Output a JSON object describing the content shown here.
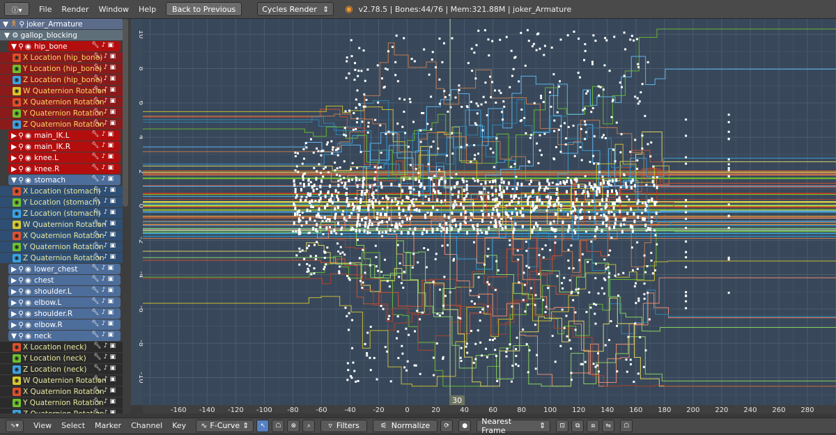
{
  "topbar": {
    "editor_icon": "info-icon",
    "menus": [
      "File",
      "Render",
      "Window",
      "Help"
    ],
    "back_button": "Back to Previous",
    "render_engine": "Cycles Render",
    "stats": "v2.78.5 | Bones:44/76  | Mem:321.88M | joker_Armature"
  },
  "channels": {
    "object": "joker_Armature",
    "action": "gallop_blocking",
    "rows": [
      {
        "label": "hip_bone",
        "type": "bone-red"
      },
      {
        "label": "X Location (hip_bone)",
        "type": "fc-red",
        "swatch": "#e0502c"
      },
      {
        "label": "Y Location (hip_bone)",
        "type": "fc-red",
        "swatch": "#6dc22d"
      },
      {
        "label": "Z Location (hip_bone)",
        "type": "fc-red",
        "swatch": "#3aa3e0"
      },
      {
        "label": "W Quaternion Rotation",
        "type": "fc-red",
        "swatch": "#d8c82e"
      },
      {
        "label": "X Quaternion Rotation",
        "type": "fc-red",
        "swatch": "#e0502c"
      },
      {
        "label": "Y Quaternion Rotation",
        "type": "fc-red",
        "swatch": "#6dc22d"
      },
      {
        "label": "Z Quaternion Rotation",
        "type": "fc-red",
        "swatch": "#3aa3e0"
      },
      {
        "label": "main_IK.L",
        "type": "bone-red"
      },
      {
        "label": "main_IK.R",
        "type": "bone-red"
      },
      {
        "label": "knee.L",
        "type": "bone-red"
      },
      {
        "label": "knee.R",
        "type": "bone-red"
      },
      {
        "label": "stomach",
        "type": "bone-blue"
      },
      {
        "label": "X Location (stomach)",
        "type": "fc-blue",
        "swatch": "#e0502c"
      },
      {
        "label": "Y Location (stomach)",
        "type": "fc-blue",
        "swatch": "#6dc22d"
      },
      {
        "label": "Z Location (stomach)",
        "type": "fc-blue",
        "swatch": "#3aa3e0"
      },
      {
        "label": "W Quaternion Rotation",
        "type": "fc-blue",
        "swatch": "#d8c82e"
      },
      {
        "label": "X Quaternion Rotation",
        "type": "fc-blue",
        "swatch": "#e0502c"
      },
      {
        "label": "Y Quaternion Rotation",
        "type": "fc-blue",
        "swatch": "#6dc22d"
      },
      {
        "label": "Z Quaternion Rotation",
        "type": "fc-blue",
        "swatch": "#3aa3e0"
      },
      {
        "label": "lower_chest",
        "type": "bone-blue"
      },
      {
        "label": "chest",
        "type": "bone-blue"
      },
      {
        "label": "shoulder.L",
        "type": "bone-blue"
      },
      {
        "label": "elbow.L",
        "type": "bone-blue"
      },
      {
        "label": "shoulder.R",
        "type": "bone-blue"
      },
      {
        "label": "elbow.R",
        "type": "bone-blue"
      },
      {
        "label": "neck",
        "type": "bone-blue"
      },
      {
        "label": "X Location (neck)",
        "type": "fc-dark",
        "swatch": "#e0502c"
      },
      {
        "label": "Y Location (neck)",
        "type": "fc-dark",
        "swatch": "#6dc22d"
      },
      {
        "label": "Z Location (neck)",
        "type": "fc-dark",
        "swatch": "#3aa3e0"
      },
      {
        "label": "W Quaternion Rotation",
        "type": "fc-dark",
        "swatch": "#d8c82e"
      },
      {
        "label": "X Quaternion Rotation",
        "type": "fc-dark",
        "swatch": "#e0502c"
      },
      {
        "label": "Y Quaternion Rotation",
        "type": "fc-dark",
        "swatch": "#6dc22d"
      },
      {
        "label": "Z Quaternion Rotation",
        "type": "fc-dark",
        "swatch": "#3aa3e0"
      }
    ]
  },
  "graph": {
    "current_frame": "30",
    "x_ticks": [
      "-160",
      "-140",
      "-120",
      "-100",
      "-80",
      "-60",
      "-40",
      "-20",
      "0",
      "20",
      "40",
      "60",
      "80",
      "100",
      "120",
      "140",
      "160",
      "180",
      "200",
      "220",
      "240",
      "260",
      "280"
    ],
    "y_ticks": [
      "10",
      "8",
      "6",
      "4",
      "2",
      "0",
      "-2",
      "-4",
      "-6",
      "-8",
      "-10"
    ]
  },
  "bottombar": {
    "menus": [
      "View",
      "Select",
      "Marker",
      "Channel",
      "Key"
    ],
    "mode": "F-Curve",
    "filters": "Filters",
    "normalize": "Normalize",
    "snap": "Nearest Frame"
  }
}
